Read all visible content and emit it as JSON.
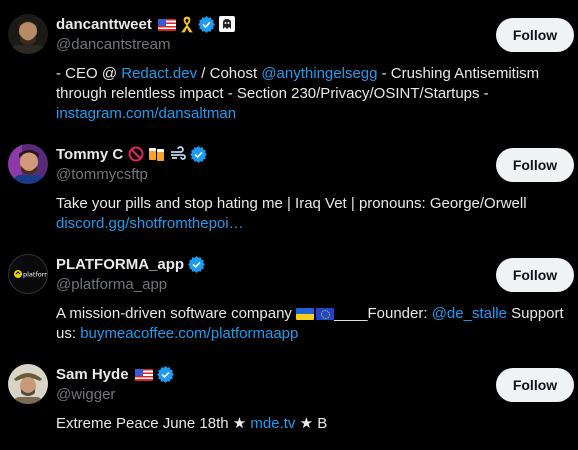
{
  "users": [
    {
      "display_name": "dancanttweet",
      "handle": "@dancantstream",
      "follow_label": "Follow",
      "bio": {
        "t1": "- CEO @ ",
        "link1": "Redact.dev",
        "t2": " / Cohost ",
        "link2": "@anythingelsegg",
        "t3": " - Crushing Antisemitism through relentless impact - Section 230/Privacy/OSINT/Startups - ",
        "link3": "instagram.com/dansaltman"
      }
    },
    {
      "display_name": "Tommy C",
      "handle": "@tommycsftp",
      "follow_label": "Follow",
      "bio": {
        "t1": "Take your pills and stop hating me | Iraq Vet | pronouns: George/Orwell",
        "link1": "discord.gg/shotfromthepoi…"
      }
    },
    {
      "display_name": "PLATFORMA_app",
      "handle": "@platforma_app",
      "follow_label": "Follow",
      "avatar_text": "platforma",
      "bio": {
        "t1": "A mission-driven software company ",
        "t2": "____Founder: ",
        "link1": "@de_stalle",
        "t3": " Support us: ",
        "link2": "buymeacoffee.com/platformaapp"
      }
    },
    {
      "display_name": "Sam Hyde",
      "handle": "@wigger",
      "follow_label": "Follow",
      "bio": {
        "t1": "Extreme Peace June 18th ★ ",
        "link1": "mde.tv",
        "t2": " ★ B"
      }
    }
  ],
  "colors": {
    "background": "#000000",
    "text": "#e7e9ea",
    "muted": "#71767b",
    "link": "#1d9bf0",
    "button_bg": "#eff3f4",
    "verified": "#1d9bf0"
  },
  "icons": [
    "verified-badge-icon",
    "us-flag-icon",
    "yellow-ribbon-icon",
    "bearded-ghost-icon",
    "prohibited-icon",
    "beer-mugs-icon",
    "wind-icon",
    "ukraine-flag-icon",
    "eu-flag-icon"
  ]
}
